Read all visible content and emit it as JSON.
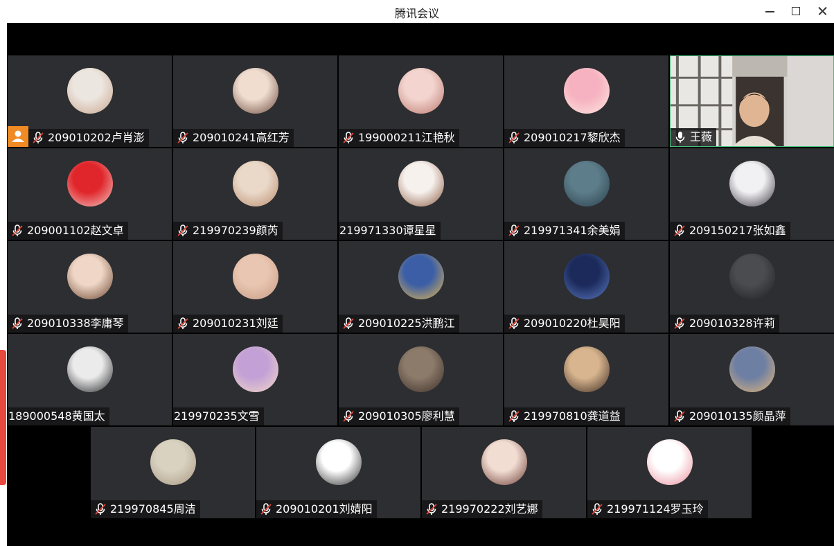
{
  "window": {
    "title": "腾讯会议"
  },
  "colors": {
    "tile_bg": "#2d2e31",
    "host_badge": "#f08a24",
    "active_border": "#42c27a"
  },
  "participants": [
    {
      "label": "209010202卢肖澎",
      "muted": true,
      "host": true,
      "avatar": [
        "#ece6e0",
        "#c9a48a"
      ]
    },
    {
      "label": "209010241高红芳",
      "muted": true,
      "avatar": [
        "#f0ddd0",
        "#6b4a3c"
      ]
    },
    {
      "label": "199000211江艳秋",
      "muted": true,
      "avatar": [
        "#f3d4cf",
        "#b9776d"
      ]
    },
    {
      "label": "209010217黎欣杰",
      "muted": true,
      "avatar": [
        "#f6b2c0",
        "#fde8e1"
      ]
    },
    {
      "label": "王薇",
      "muted": false,
      "video": true
    },
    {
      "label": "209001102赵文卓",
      "muted": true,
      "avatar": [
        "#e0262b",
        "#f2c8c4"
      ]
    },
    {
      "label": "219970239颜芮",
      "muted": true,
      "avatar": [
        "#ead9c9",
        "#b88b6c"
      ]
    },
    {
      "label": "219971330谭星星",
      "muted": false,
      "noicon": true,
      "avatar": [
        "#f7f1ee",
        "#8a5a40"
      ]
    },
    {
      "label": "219971341余美娟",
      "muted": true,
      "avatar": [
        "#5d7d8a",
        "#2a3f4c"
      ]
    },
    {
      "label": "209150217张如鑫",
      "muted": true,
      "avatar": [
        "#f1f1f3",
        "#3b3440"
      ]
    },
    {
      "label": "209010338李庸琴",
      "muted": true,
      "avatar": [
        "#efd6c6",
        "#6b4630"
      ]
    },
    {
      "label": "209010231刘廷",
      "muted": true,
      "avatar": [
        "#e9c6b1",
        "#c79b86"
      ]
    },
    {
      "label": "209010225洪鹏江",
      "muted": true,
      "avatar": [
        "#3b5ea6",
        "#e6b94f"
      ]
    },
    {
      "label": "209010220杜昊阳",
      "muted": true,
      "avatar": [
        "#1c2a5b",
        "#5b7bc2"
      ]
    },
    {
      "label": "209010328许莉",
      "muted": true,
      "avatar": [
        "#4a4c50",
        "#1e1f22"
      ]
    },
    {
      "label": "189000548黄国太",
      "muted": false,
      "noicon": true,
      "avatar": [
        "#ecebeb",
        "#202226"
      ]
    },
    {
      "label": "219970235文雪",
      "muted": false,
      "noicon": true,
      "avatar": [
        "#c3a1d6",
        "#f3d9c5"
      ]
    },
    {
      "label": "209010305廖利慧",
      "muted": true,
      "avatar": [
        "#8c7a6a",
        "#3a2e28"
      ]
    },
    {
      "label": "219970810龚道益",
      "muted": true,
      "avatar": [
        "#d8b58e",
        "#3b2a22"
      ]
    },
    {
      "label": "209010135颜晶萍",
      "muted": true,
      "avatar": [
        "#6d7fa3",
        "#e4b77a"
      ]
    },
    {
      "label": "219970845周洁",
      "muted": true,
      "avatar": [
        "#d9d2c1",
        "#a79780"
      ]
    },
    {
      "label": "209010201刘婧阳",
      "muted": true,
      "avatar": [
        "#ffffff",
        "#2a2a2a"
      ]
    },
    {
      "label": "219970222刘艺娜",
      "muted": true,
      "avatar": [
        "#f2ddd3",
        "#6a3b33"
      ]
    },
    {
      "label": "219971124罗玉玲",
      "muted": true,
      "avatar": [
        "#ffffff",
        "#e88c9a"
      ]
    }
  ]
}
